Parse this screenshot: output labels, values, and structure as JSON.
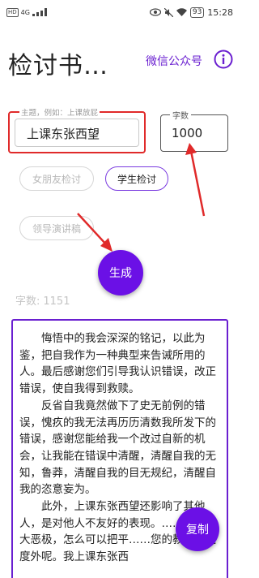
{
  "status_bar": {
    "network_badge": "HD",
    "signal": "4G",
    "battery": "93",
    "time": "15:28"
  },
  "header": {
    "title": "检讨书…",
    "wechat_link": "微信公众号",
    "info_icon": "info-circle-icon"
  },
  "form": {
    "topic": {
      "hint": "主题，例如：上课放屁",
      "value": "上课东张西望"
    },
    "count": {
      "label": "字数",
      "value": "1000"
    }
  },
  "chips": [
    {
      "label": "女朋友检讨",
      "selected": false
    },
    {
      "label": "学生检讨",
      "selected": true
    },
    {
      "label": "领导演讲稿",
      "selected": false
    }
  ],
  "generate_button": "生成",
  "word_count": {
    "label": "字数:",
    "value": "1151"
  },
  "result": {
    "paragraphs": [
      "悔悟中的我会深深的铭记，以此为鉴，把自我作为一种典型来告诫所用的人。最后感谢您们引导我认识错误，改正错误，使自我得到救赎。",
      "反省自我竟然做下了史无前例的错误，愧疚的我无法再历历清数我所发下的错误，感谢您能给我一个改过自新的机会，让我能在错误中清醒，清醒自我的无知，鲁莽，清醒自我的目无规纪，清醒自我的恣意妄为。",
      "此外，上课东张西望还影响了其他人，是对他人不友好的表现。……真的罪大恶极，怎么可以把平……您的教导置之度外呢。我上课东张西"
    ]
  },
  "copy_button": "复制",
  "colors": {
    "accent": "#6b10e6",
    "annotation": "#e02a2a"
  }
}
